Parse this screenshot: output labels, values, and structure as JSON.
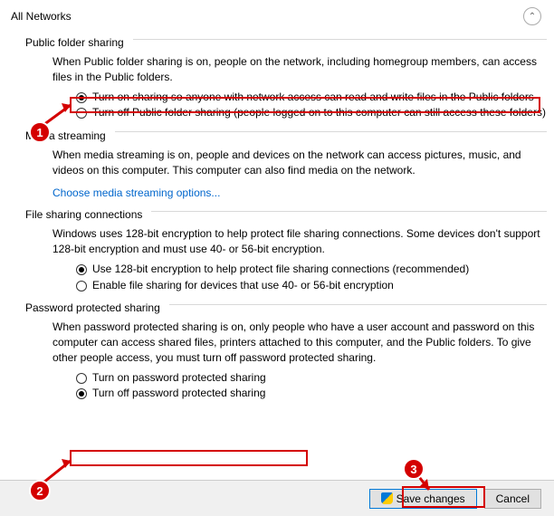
{
  "header": {
    "title": "All Networks"
  },
  "sections": {
    "public_folder": {
      "title": "Public folder sharing",
      "desc": "When Public folder sharing is on, people on the network, including homegroup members, can access files in the Public folders.",
      "opt_on": "Turn on sharing so anyone with network access can read and write files in the Public folders",
      "opt_off": "Turn off Public folder sharing (people logged on to this computer can still access these folders)"
    },
    "media": {
      "title": "Media streaming",
      "desc": "When media streaming is on, people and devices on the network can access pictures, music, and videos on this computer. This computer can also find media on the network.",
      "link": "Choose media streaming options..."
    },
    "encryption": {
      "title": "File sharing connections",
      "desc": "Windows uses 128-bit encryption to help protect file sharing connections. Some devices don't support 128-bit encryption and must use 40- or 56-bit encryption.",
      "opt_128": "Use 128-bit encryption to help protect file sharing connections (recommended)",
      "opt_4056": "Enable file sharing for devices that use 40- or 56-bit encryption"
    },
    "password": {
      "title": "Password protected sharing",
      "desc": "When password protected sharing is on, only people who have a user account and password on this computer can access shared files, printers attached to this computer, and the Public folders. To give other people access, you must turn off password protected sharing.",
      "opt_on": "Turn on password protected sharing",
      "opt_off": "Turn off password protected sharing"
    }
  },
  "footer": {
    "save": "Save changes",
    "cancel": "Cancel"
  },
  "annotations": {
    "n1": "1",
    "n2": "2",
    "n3": "3"
  }
}
